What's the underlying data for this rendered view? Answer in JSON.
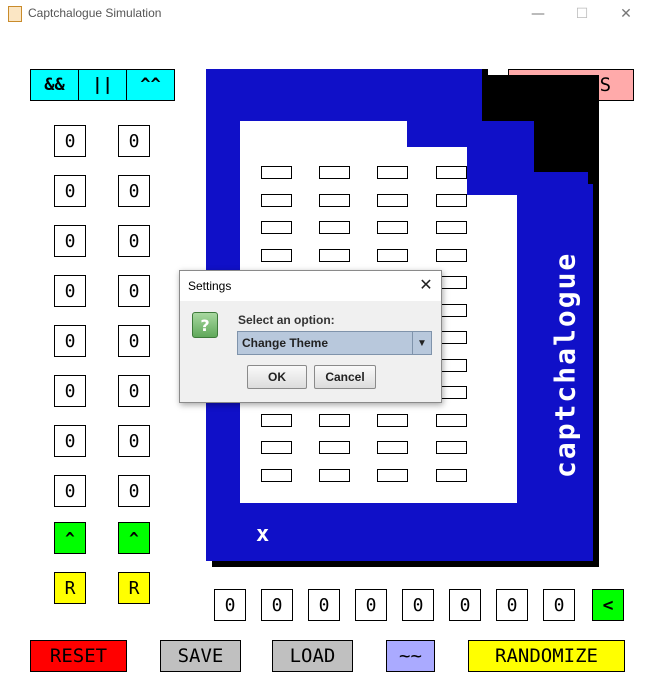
{
  "window": {
    "title": "Captchalogue Simulation",
    "minimize": "—",
    "maximize": "☐",
    "close": "✕"
  },
  "logic_ops": [
    "&&",
    "||",
    "^^"
  ],
  "options_label": "OPTIONS",
  "left_column": [
    "0",
    "0",
    "0",
    "0",
    "0",
    "0",
    "0",
    "0"
  ],
  "right_column": [
    "0",
    "0",
    "0",
    "0",
    "0",
    "0",
    "0",
    "0"
  ],
  "shift_up_label": "^",
  "reverse_label": "R",
  "card": {
    "vertical_text": "captchalogue",
    "x_mark": "x"
  },
  "bottom_bits": [
    "0",
    "0",
    "0",
    "0",
    "0",
    "0",
    "0",
    "0"
  ],
  "shift_left_label": "<",
  "bottom_buttons": {
    "reset": "RESET",
    "save": "SAVE",
    "load": "LOAD",
    "tilde": "~~",
    "randomize": "RANDOMIZE"
  },
  "dialog": {
    "title": "Settings",
    "label": "Select an option:",
    "selected": "Change Theme",
    "ok": "OK",
    "cancel": "Cancel",
    "icon_glyph": "?"
  },
  "colors": {
    "cyan": "#00ffff",
    "pink": "#ffaaaa",
    "blue": "#1010c8",
    "green": "#00ff00",
    "yellow": "#ffff00",
    "red": "#ff0000",
    "gray": "#c0c0c0",
    "lavender": "#aaaaff"
  }
}
